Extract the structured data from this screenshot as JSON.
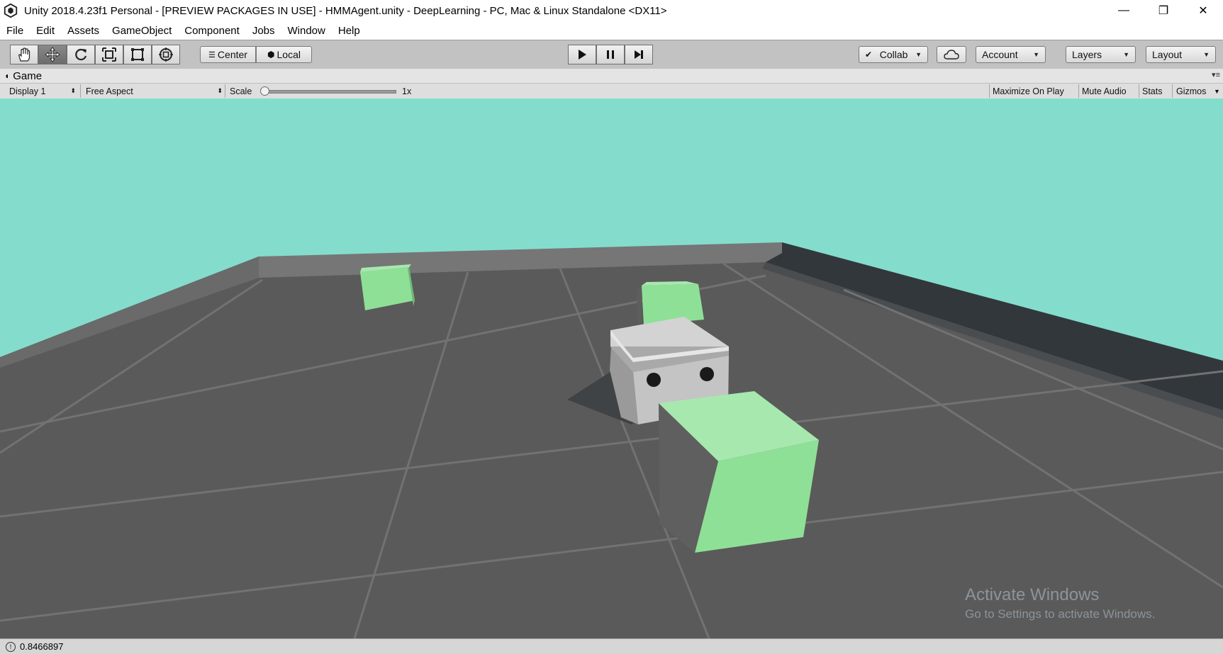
{
  "window": {
    "title": "Unity 2018.4.23f1 Personal - [PREVIEW PACKAGES IN USE] - HMMAgent.unity - DeepLearning - PC, Mac & Linux Standalone <DX11>",
    "minimize_glyph": "—",
    "restore_glyph": "❐",
    "close_glyph": "✕"
  },
  "menu": {
    "items": [
      "File",
      "Edit",
      "Assets",
      "GameObject",
      "Component",
      "Jobs",
      "Window",
      "Help"
    ]
  },
  "toolbar": {
    "tools": [
      "hand-tool",
      "move-tool",
      "rotate-tool",
      "scale-tool",
      "rect-tool",
      "transform-tool"
    ],
    "active_tool": "move-tool",
    "pivot_label": "Center",
    "space_label": "Local",
    "collab_label": "Collab",
    "account_label": "Account",
    "layers_label": "Layers",
    "layout_label": "Layout"
  },
  "game_view": {
    "tab_label": "Game",
    "display_label": "Display 1",
    "aspect_label": "Free Aspect",
    "scale_label": "Scale",
    "scale_value": "1x",
    "maximize_label": "Maximize On Play",
    "mute_label": "Mute Audio",
    "stats_label": "Stats",
    "gizmos_label": "Gizmos"
  },
  "scene": {
    "sky_color": "#84ddcc",
    "ground_color": "#5a5a5a",
    "cube_color": "#8fe097",
    "agent_color": "#c4c4c4"
  },
  "status": {
    "message": "0.8466897"
  },
  "watermark": {
    "line1": "Activate Windows",
    "line2": "Go to Settings to activate Windows."
  }
}
